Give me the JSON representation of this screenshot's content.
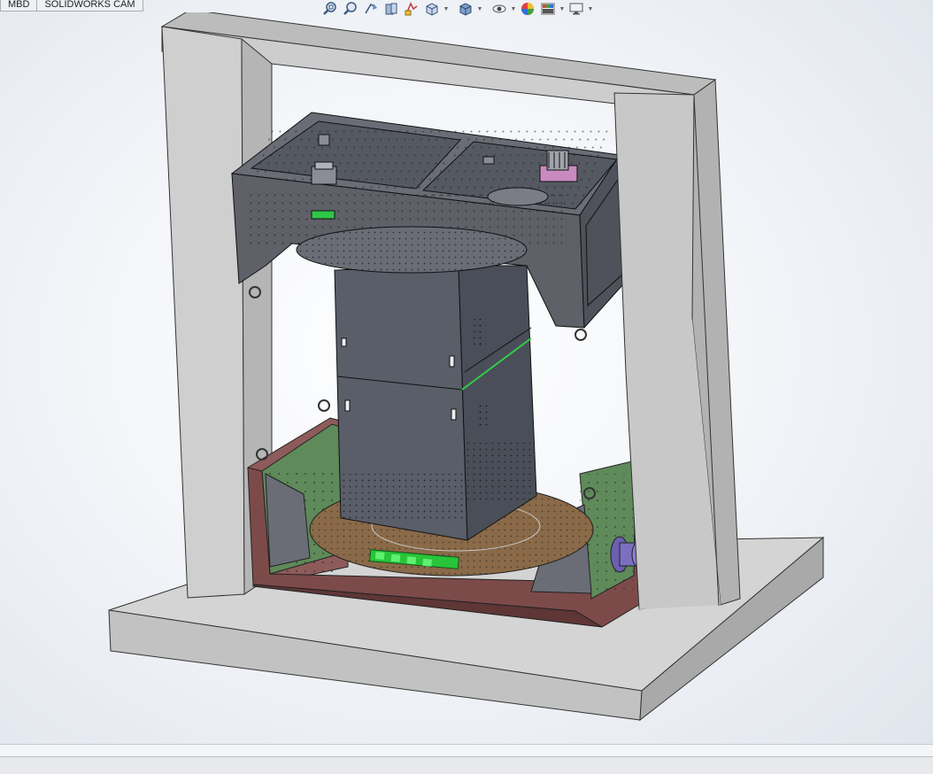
{
  "tabs": [
    {
      "label": "MBD"
    },
    {
      "label": "SOLIDWORKS CAM"
    }
  ],
  "toolbar": {
    "icons": [
      "zoom-to-fit-icon",
      "zoom-to-area-icon",
      "previous-view-icon",
      "section-view-icon",
      "dynamic-annotation-views-icon",
      "view-orientation-icon",
      "display-style-icon",
      "hide-show-items-icon",
      "edit-appearance-icon",
      "apply-scene-icon",
      "view-settings-icon"
    ]
  },
  "colors": {
    "frame": "#c8c8c8",
    "housing": "#5e6168",
    "base_box": "#7d4a4a",
    "green_panel": "#5f8a5a",
    "turntable": "#8a6a48",
    "cabinet": "#5a5e69"
  }
}
